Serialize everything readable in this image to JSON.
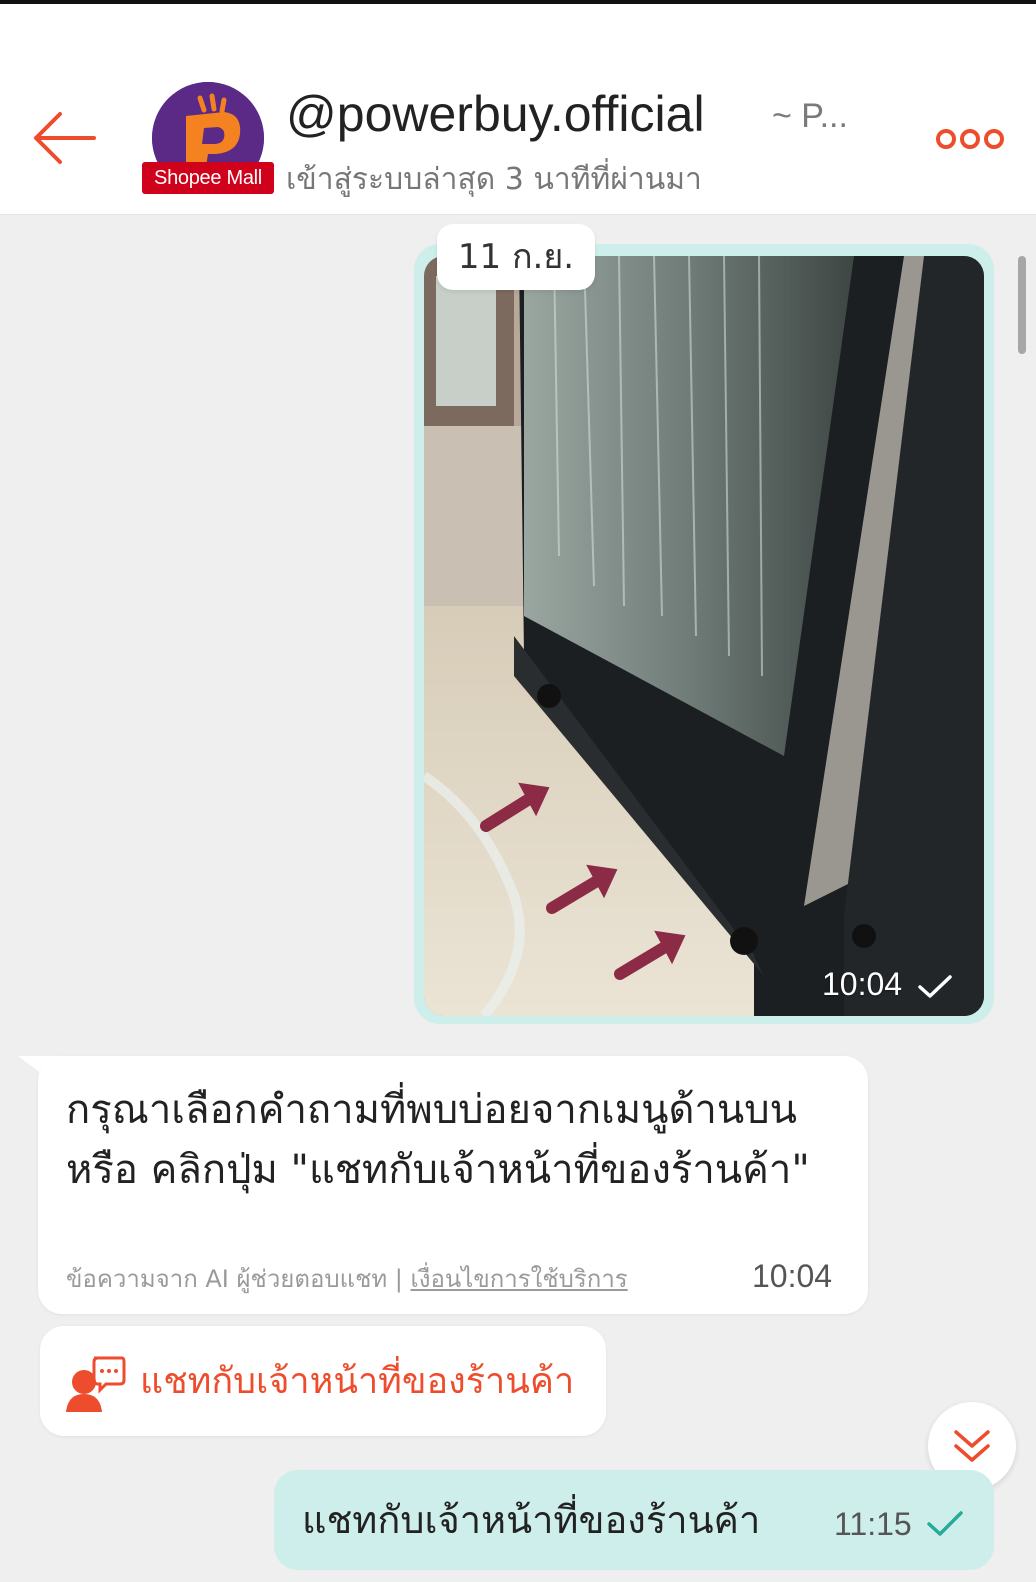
{
  "header": {
    "shop_name": "@powerbuy.official",
    "shop_name_suffix": "~ P...",
    "badge": "Shopee Mall",
    "last_seen": "เข้าสู่ระบบล่าสุด 3 นาทีที่ผ่านมา",
    "accent_color": "#ee4d2d"
  },
  "messages": {
    "date": "11 ก.ย.",
    "image_message": {
      "time": "10:04",
      "status": "sent"
    },
    "ai_reply": {
      "text": "กรุณาเลือกคำถามที่พบบ่อยจากเมนูด้านบน หรือ คลิกปุ่ม \"แชทกับเจ้าหน้าที่ของร้านค้า\"",
      "footer_note": "ข้อความจาก AI ผู้ช่วยตอบแชท | ",
      "footer_link": "เงื่อนไขการใช้บริการ",
      "time": "10:04"
    },
    "agent_button": {
      "label": "แชทกับเจ้าหน้าที่ของร้านค้า",
      "icon": "chat-agent-icon"
    },
    "my_message": {
      "text": "แชทกับเจ้าหน้าที่ของร้านค้า",
      "time": "11:15",
      "status": "sent"
    }
  }
}
